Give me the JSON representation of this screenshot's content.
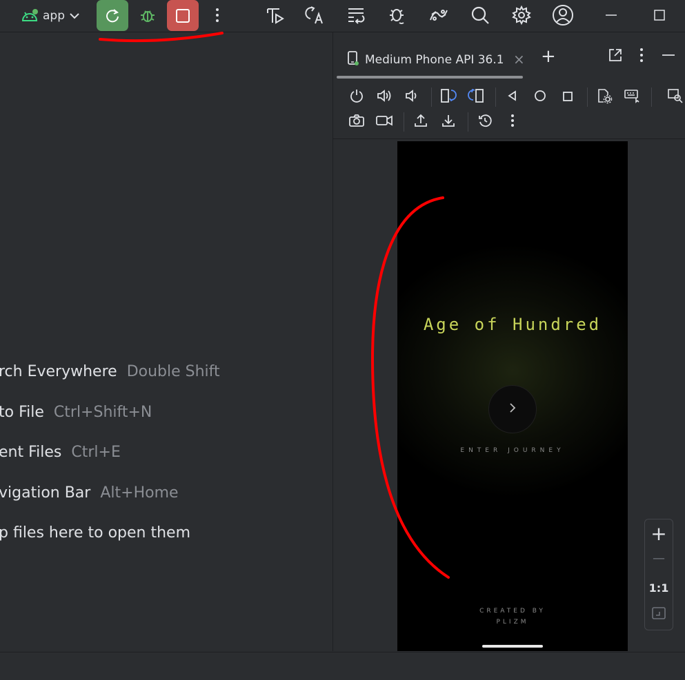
{
  "toolbar": {
    "app_label": "app",
    "icons": [
      "android-icon",
      "chevron-down-icon",
      "rerun-icon",
      "debug-icon",
      "stop-icon",
      "more-vert-icon",
      "profile-run-icon",
      "translate-icon",
      "format-icon",
      "bug-sync-icon",
      "device-mirror-icon",
      "search-icon",
      "settings-icon",
      "account-icon",
      "minimize-icon",
      "maximize-icon"
    ]
  },
  "editor": {
    "hints": [
      {
        "label": "rch Everywhere",
        "shortcut": "Double Shift"
      },
      {
        "label": "to File",
        "shortcut": "Ctrl+Shift+N"
      },
      {
        "label": "ent Files",
        "shortcut": "Ctrl+E"
      },
      {
        "label": "vigation Bar",
        "shortcut": "Alt+Home"
      },
      {
        "label": "p files here to open them",
        "shortcut": ""
      }
    ]
  },
  "device_panel": {
    "tab_label": "Medium Phone API 36.1",
    "close_glyph": "×",
    "add_glyph": "+"
  },
  "app_screen": {
    "title": "Age of Hundred",
    "enter_label": "ENTER JOURNEY",
    "credit_line1": "CREATED BY",
    "credit_line2": "PLIZM"
  },
  "zoom": {
    "plus": "+",
    "minus": "—",
    "one_to_one": "1:1"
  },
  "colors": {
    "run_green": "#57965c",
    "stop_red": "#c75450",
    "title_yellow": "#c8d55a",
    "annotation_red": "#ff0000"
  }
}
